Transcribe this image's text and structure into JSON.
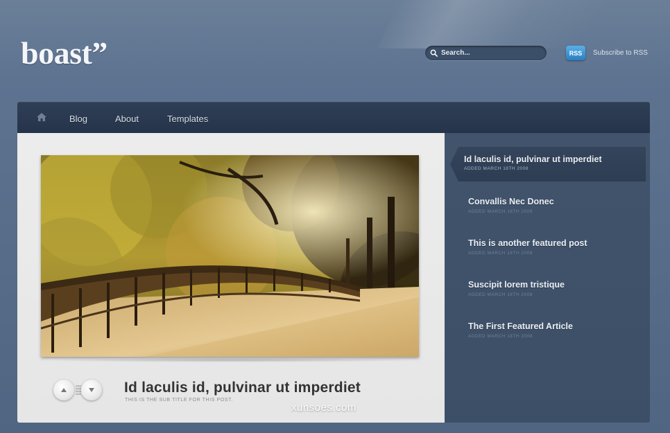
{
  "site": {
    "logo": "boast”"
  },
  "header": {
    "search": {
      "placeholder": "Search..."
    },
    "rss": {
      "badge": "RSS",
      "label": "Subscribe to RSS"
    }
  },
  "nav": {
    "items": [
      {
        "label": "Blog"
      },
      {
        "label": "About"
      },
      {
        "label": "Templates"
      }
    ]
  },
  "featured": {
    "title": "Id laculis id, pulvinar ut imperdiet",
    "subtitle": "This is the sub title for this post."
  },
  "sidebar": {
    "items": [
      {
        "title": "Id laculis id, pulvinar ut imperdiet",
        "date": "Added March 18th 2008",
        "active": true
      },
      {
        "title": "Convallis Nec Donec",
        "date": "Added March 18th 2008"
      },
      {
        "title": "This is another featured post",
        "date": "Added March 18th 2008"
      },
      {
        "title": "Suscipit lorem tristique",
        "date": "Added March 18th 2008"
      },
      {
        "title": "The First Featured Article",
        "date": "Added March 18th 2008"
      }
    ]
  },
  "watermark": "xunsoes.com",
  "colors": {
    "background": "#566c89",
    "nav": "#2a3a50",
    "sidebar": "#3f5169",
    "content": "#e8e8e8",
    "rss": "#2a7fc0"
  },
  "icons": [
    "home-icon",
    "search-icon",
    "rss-icon",
    "arrow-up-icon",
    "arrow-down-icon"
  ]
}
